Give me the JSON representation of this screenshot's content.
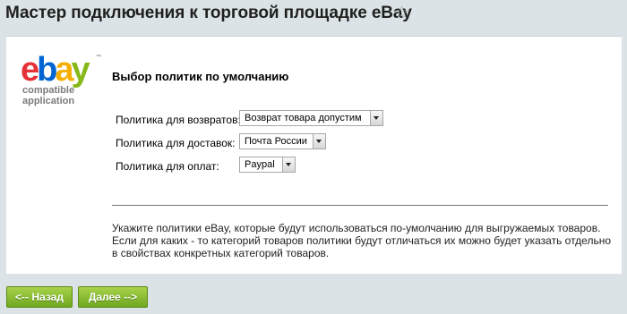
{
  "page": {
    "title": "Мастер подключения к торговой площадке eBay"
  },
  "logo": {
    "letters": [
      "e",
      "b",
      "a",
      "y"
    ],
    "tm": "™",
    "sub_line1": "compatible",
    "sub_line2": "application",
    "colors": [
      "#e53238",
      "#0064d2",
      "#f5af02",
      "#86b817"
    ]
  },
  "section": {
    "title": "Выбор политик по умолчанию"
  },
  "form": {
    "returns": {
      "label": "Политика для возвратов:",
      "value": "Возврат товара допустим"
    },
    "shipping": {
      "label": "Политика для доставок:",
      "value": "Почта России"
    },
    "payment": {
      "label": "Политика для оплат:",
      "value": "Paypal"
    }
  },
  "help": {
    "line1": "Укажите политики eBay, которые будут использоваться по-умолчанию для выгружаемых товаров.",
    "line2": "Если для каких - то категорий товаров политики будут отличаться их можно будет указать отдельно",
    "line3": "в свойствах конкретных категорий товаров."
  },
  "buttons": {
    "back": "<-- Назад",
    "next": "Далее -->"
  }
}
